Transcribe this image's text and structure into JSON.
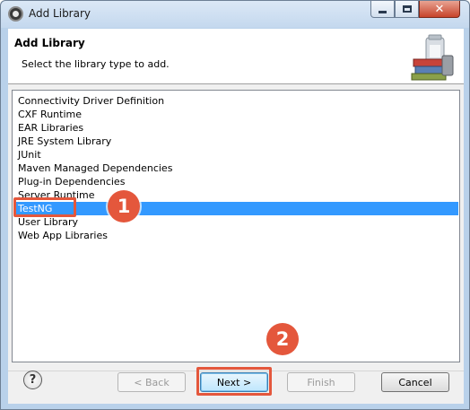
{
  "window": {
    "title": "Add Library"
  },
  "header": {
    "title": "Add Library",
    "subtitle": "Select the library type to add."
  },
  "list": {
    "items": [
      "Connectivity Driver Definition",
      "CXF Runtime",
      "EAR Libraries",
      "JRE System Library",
      "JUnit",
      "Maven Managed Dependencies",
      "Plug-in Dependencies",
      "Server Runtime",
      "TestNG",
      "User Library",
      "Web App Libraries"
    ],
    "selected": "TestNG"
  },
  "callouts": {
    "step1": "1",
    "step2": "2",
    "color": "#e4573c"
  },
  "buttons": {
    "help": "?",
    "back": "< Back",
    "next": "Next >",
    "finish": "Finish",
    "cancel": "Cancel"
  },
  "colors": {
    "selection": "#3399ff",
    "frame": "#b9d1ea"
  }
}
